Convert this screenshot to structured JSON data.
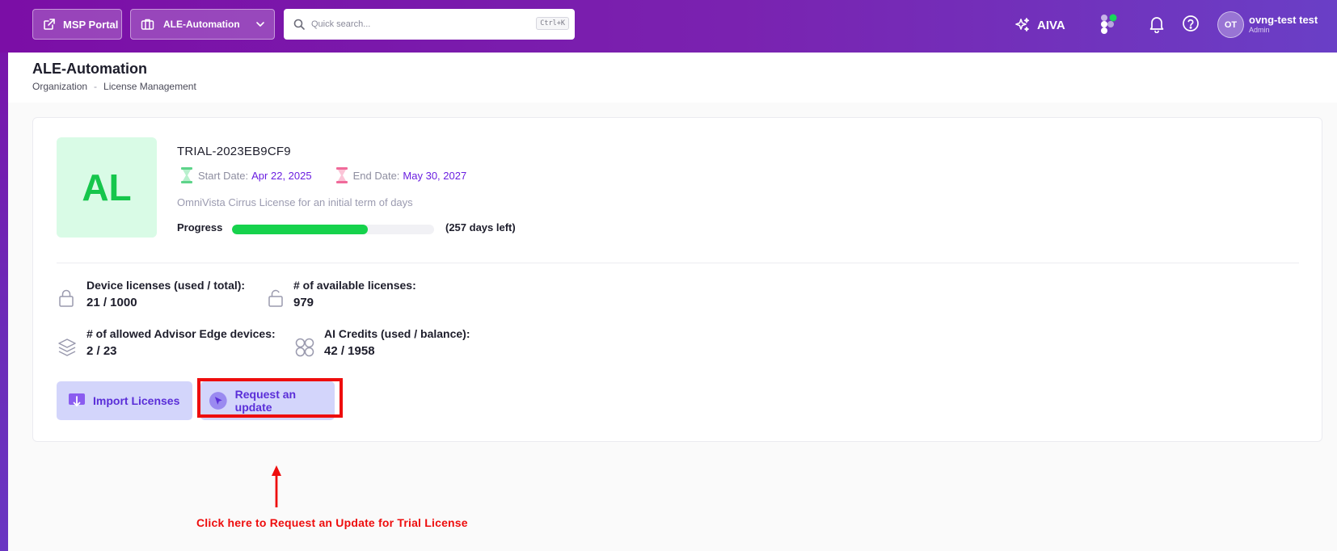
{
  "topbar": {
    "msp_portal_label": "MSP Portal",
    "org_selector_label": "ALE-Automation",
    "search_placeholder": "Quick search...",
    "search_shortcut": "Ctrl+K",
    "aiva_label": "AIVA",
    "user_initials": "OT",
    "user_name": "ovng-test test",
    "user_role": "Admin"
  },
  "page": {
    "title": "ALE-Automation",
    "breadcrumb": [
      "Organization",
      "License Management"
    ],
    "breadcrumb_separator": "-"
  },
  "license": {
    "avatar_initials": "AL",
    "id": "TRIAL-2023EB9CF9",
    "start_label": "Start Date:",
    "start_date": "Apr 22, 2025",
    "end_label": "End Date:",
    "end_date": "May 30, 2027",
    "description": "OmniVista Cirrus License for an initial term of days",
    "progress_label": "Progress",
    "progress_fraction": 0.67,
    "days_left": "(257 days left)"
  },
  "stats": {
    "device_licenses_label": "Device licenses (used / total):",
    "device_licenses_value": "21 / 1000",
    "available_licenses_label": "# of available licenses:",
    "available_licenses_value": "979",
    "advisor_edge_label": "# of allowed Advisor Edge devices:",
    "advisor_edge_value": "2 / 23",
    "ai_credits_label": "AI Credits (used / balance):",
    "ai_credits_value": "42 / 1958"
  },
  "actions": {
    "import_label": "Import Licenses",
    "request_label": "Request an update"
  },
  "annotation": {
    "text": "Click here to Request an Update for Trial License"
  },
  "colors": {
    "brand_purple": "#7a1aa8",
    "accent_text": "#5a2ed8",
    "progress_green": "#16d24c",
    "annotation_red": "#ee0d0d"
  },
  "icons": [
    "external-link-icon",
    "briefcase-icon",
    "chevron-down-icon",
    "search-icon",
    "sparkle-icon",
    "apps-icon",
    "bell-icon",
    "help-icon",
    "hourglass-icon",
    "lock-icon",
    "unlock-icon",
    "layers-icon",
    "circles-icon",
    "download-icon",
    "cursor-icon",
    "arrow-up-icon"
  ]
}
